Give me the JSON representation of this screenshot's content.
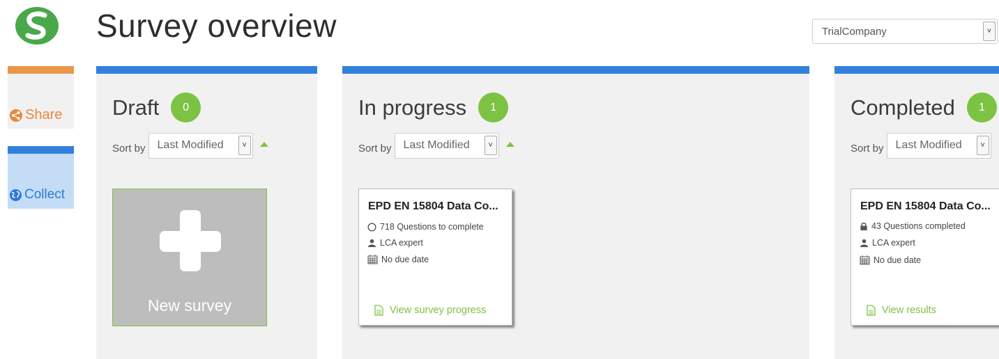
{
  "header": {
    "title": "Survey overview",
    "company_select": {
      "value": "TrialCompany"
    }
  },
  "sidebar": {
    "items": [
      {
        "label": "Share",
        "icon": "share-icon",
        "accent": "#e8974a"
      },
      {
        "label": "Collect",
        "icon": "globe-icon",
        "accent": "#3380dc"
      }
    ]
  },
  "columns": {
    "draft": {
      "title": "Draft",
      "count": "0",
      "sort_label": "Sort by",
      "sort_value": "Last Modified",
      "new_survey_label": "New survey"
    },
    "in_progress": {
      "title": "In progress",
      "count": "1",
      "sort_label": "Sort by",
      "sort_value": "Last Modified",
      "card": {
        "title": "EPD EN 15804 Data Co...",
        "questions": "718 Questions to complete",
        "role": "LCA expert",
        "due": "No due date",
        "link": "View survey progress"
      }
    },
    "completed": {
      "title": "Completed",
      "count": "1",
      "sort_label": "Sort by",
      "sort_value": "Last Modified",
      "card": {
        "title": "EPD EN 15804 Data Co...",
        "questions": "43 Questions completed",
        "role": "LCA expert",
        "due": "No due date",
        "link": "View results"
      }
    }
  },
  "colors": {
    "brand_green": "#7cc243",
    "column_blue": "#3380dc",
    "share_orange": "#e8974a",
    "logo_green": "#4aa84b"
  }
}
